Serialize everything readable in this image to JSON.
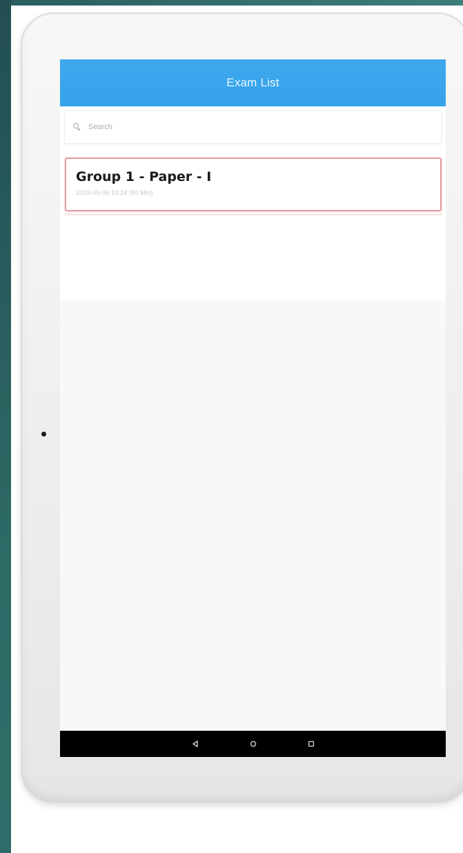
{
  "app": {
    "title": "Exam List"
  },
  "search": {
    "placeholder": "Search"
  },
  "exams": [
    {
      "title": "Group 1 - Paper - I",
      "meta": "2019-09-06 10:24 (60 Min)"
    }
  ],
  "nav": {
    "icons": [
      "back-icon",
      "home-icon",
      "recents-icon"
    ]
  },
  "colors": {
    "header": "#3ea8ee",
    "item_border": "#e29a9a",
    "nav_bar": "#000000"
  }
}
